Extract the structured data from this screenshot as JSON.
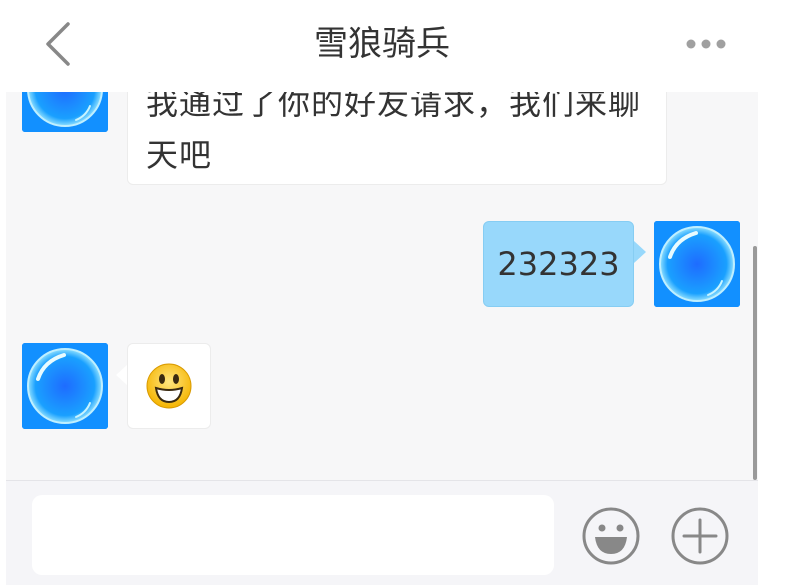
{
  "header": {
    "title": "雪狼骑兵",
    "back_icon": "chevron-left-icon",
    "more_icon": "more-horizontal-icon"
  },
  "messages": [
    {
      "side": "left",
      "text": "我通过了你的好友请求，我们来聊天吧"
    },
    {
      "side": "right",
      "text": "232323"
    },
    {
      "side": "left",
      "emoji": "smiley-emoji-icon"
    }
  ],
  "input_bar": {
    "placeholder": "",
    "emoji_icon": "emoji-face-icon",
    "plus_icon": "plus-circle-icon"
  },
  "colors": {
    "background": "#f7f7f8",
    "header_background": "#ffffff",
    "outgoing_bubble": "#98d8fb",
    "incoming_bubble": "#ffffff",
    "avatar": "#1a8cff",
    "icon_gray": "#888888"
  }
}
